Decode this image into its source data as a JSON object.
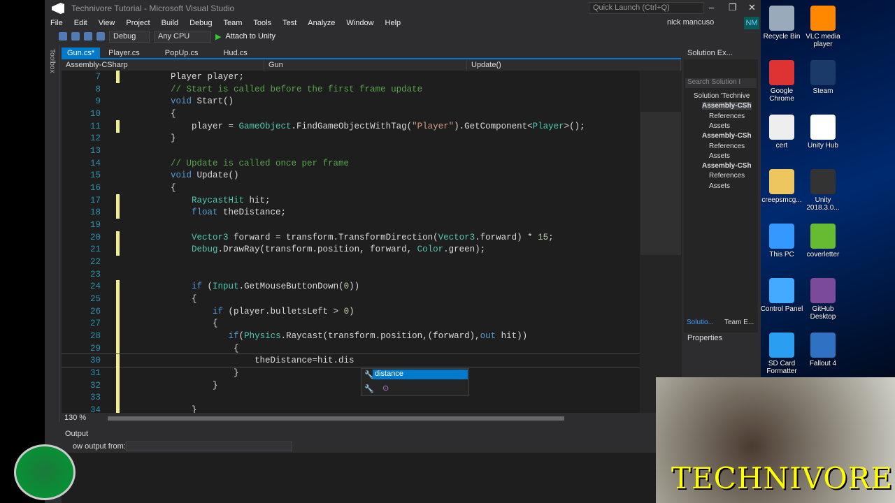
{
  "window": {
    "title": "Technivore Tutorial - Microsoft Visual Studio",
    "quick_launch": "Quick Launch (Ctrl+Q)",
    "user": "nick mancuso",
    "initials": "NM"
  },
  "menu": [
    "File",
    "Edit",
    "View",
    "Project",
    "Build",
    "Debug",
    "Team",
    "Tools",
    "Test",
    "Analyze",
    "Window",
    "Help"
  ],
  "toolbar": {
    "config": "Debug",
    "platform": "Any CPU",
    "run": "Attach to Unity"
  },
  "toolbox_label": "Toolbox",
  "tabs": [
    "Gun.cs*",
    "Player.cs",
    "PopUp.cs",
    "Hud.cs"
  ],
  "nav": {
    "project": "Assembly-CSharp",
    "class": "Gun",
    "member": "Update()"
  },
  "code": [
    {
      "n": "7",
      "t": [
        [
          "        ",
          ""
        ],
        [
          "Player player;",
          "tx"
        ]
      ]
    },
    {
      "n": "8",
      "t": [
        [
          "        ",
          ""
        ],
        [
          "// Start is called before the first frame update",
          "cm"
        ]
      ]
    },
    {
      "n": "9",
      "t": [
        [
          "        ",
          ""
        ],
        [
          "void",
          "kw"
        ],
        [
          " Start()",
          "tx"
        ]
      ]
    },
    {
      "n": "10",
      "t": [
        [
          "        {",
          "tx"
        ]
      ]
    },
    {
      "n": "11",
      "t": [
        [
          "            player = ",
          "tx"
        ],
        [
          "GameObject",
          "ty"
        ],
        [
          ".FindGameObjectWithTag(",
          "tx"
        ],
        [
          "\"Player\"",
          "st"
        ],
        [
          ").GetComponent<",
          "tx"
        ],
        [
          "Player",
          "ty"
        ],
        [
          ">();",
          "tx"
        ]
      ]
    },
    {
      "n": "12",
      "t": [
        [
          "        }",
          "tx"
        ]
      ]
    },
    {
      "n": "13",
      "t": []
    },
    {
      "n": "14",
      "t": [
        [
          "        ",
          ""
        ],
        [
          "// Update is called once per frame",
          "cm"
        ]
      ]
    },
    {
      "n": "15",
      "t": [
        [
          "        ",
          ""
        ],
        [
          "void",
          "kw"
        ],
        [
          " Update()",
          "tx"
        ]
      ]
    },
    {
      "n": "16",
      "t": [
        [
          "        {",
          "tx"
        ]
      ]
    },
    {
      "n": "17",
      "t": [
        [
          "            ",
          ""
        ],
        [
          "RaycastHit",
          "ty"
        ],
        [
          " hit;",
          "tx"
        ]
      ]
    },
    {
      "n": "18",
      "t": [
        [
          "            ",
          ""
        ],
        [
          "float",
          "kw"
        ],
        [
          " theDistance;",
          "tx"
        ]
      ]
    },
    {
      "n": "19",
      "t": []
    },
    {
      "n": "20",
      "t": [
        [
          "            ",
          ""
        ],
        [
          "Vector3",
          "ty"
        ],
        [
          " forward = transform.TransformDirection(",
          "tx"
        ],
        [
          "Vector3",
          "ty"
        ],
        [
          ".forward) * ",
          "tx"
        ],
        [
          "15",
          "nu"
        ],
        [
          ";",
          "tx"
        ]
      ]
    },
    {
      "n": "21",
      "t": [
        [
          "            ",
          ""
        ],
        [
          "Debug",
          "ty"
        ],
        [
          ".DrawRay(transform.position, forward, ",
          "tx"
        ],
        [
          "Color",
          "ty"
        ],
        [
          ".green);",
          "tx"
        ]
      ]
    },
    {
      "n": "22",
      "t": []
    },
    {
      "n": "23",
      "t": []
    },
    {
      "n": "24",
      "t": [
        [
          "            ",
          ""
        ],
        [
          "if",
          "kw"
        ],
        [
          " (",
          "tx"
        ],
        [
          "Input",
          "ty"
        ],
        [
          ".GetMouseButtonDown(",
          "tx"
        ],
        [
          "0",
          "nu"
        ],
        [
          "))",
          "tx"
        ]
      ]
    },
    {
      "n": "25",
      "t": [
        [
          "            {",
          "tx"
        ]
      ]
    },
    {
      "n": "26",
      "t": [
        [
          "                ",
          ""
        ],
        [
          "if",
          "kw"
        ],
        [
          " (player.bulletsLeft > ",
          "tx"
        ],
        [
          "0",
          "nu"
        ],
        [
          ")",
          "tx"
        ]
      ]
    },
    {
      "n": "27",
      "t": [
        [
          "                {",
          "tx"
        ]
      ]
    },
    {
      "n": "28",
      "t": [
        [
          "                   ",
          ""
        ],
        [
          "if",
          "kw"
        ],
        [
          "(",
          "tx"
        ],
        [
          "Physics",
          "ty"
        ],
        [
          ".Raycast(transform.position,(forward),",
          "tx"
        ],
        [
          "out",
          "kw"
        ],
        [
          " hit))",
          "tx"
        ]
      ]
    },
    {
      "n": "29",
      "t": [
        [
          "                    {",
          "tx"
        ]
      ]
    },
    {
      "n": "30",
      "t": [
        [
          "                        theDistance=hit.dis",
          "tx"
        ]
      ]
    },
    {
      "n": "31",
      "t": [
        [
          "                    }",
          "tx"
        ]
      ]
    },
    {
      "n": "32",
      "t": [
        [
          "                }",
          "tx"
        ]
      ]
    },
    {
      "n": "33",
      "t": []
    },
    {
      "n": "34",
      "t": [
        [
          "            }",
          "tx"
        ]
      ]
    }
  ],
  "autocomplete": {
    "selected": "distance"
  },
  "zoom": "130 %",
  "output": {
    "title": "Output",
    "show_from": "ow output from:"
  },
  "solution_explorer": {
    "title": "Solution Ex...",
    "search": "Search Solution I",
    "items": [
      "Solution 'Technive",
      "Assembly-CSh",
      "References",
      "Assets",
      "Assembly-CSh",
      "References",
      "Assets",
      "Assembly-CSh",
      "References",
      "Assets"
    ],
    "tabs": [
      "Solutio...",
      "Team E..."
    ]
  },
  "properties": {
    "title": "Properties"
  },
  "desktop": [
    {
      "label": "Recycle Bin",
      "color": "#9ab"
    },
    {
      "label": "VLC media player",
      "color": "#f80"
    },
    {
      "label": "Google Chrome",
      "color": "#d33"
    },
    {
      "label": "Steam",
      "color": "#1b3a6a"
    },
    {
      "label": "cert",
      "color": "#eee"
    },
    {
      "label": "Unity Hub",
      "color": "#fff"
    },
    {
      "label": "creepsmcg...",
      "color": "#eec660"
    },
    {
      "label": "Unity 2018.3.0...",
      "color": "#333"
    },
    {
      "label": "This PC",
      "color": "#39f"
    },
    {
      "label": "coverletter",
      "color": "#6b3"
    },
    {
      "label": "Control Panel",
      "color": "#4af"
    },
    {
      "label": "GitHub Desktop",
      "color": "#7b4a9a"
    },
    {
      "label": "SD Card Formatter",
      "color": "#2a9ef0"
    },
    {
      "label": "Fallout 4",
      "color": "#2f72c4"
    }
  ],
  "brand": "TECHNIVORE"
}
